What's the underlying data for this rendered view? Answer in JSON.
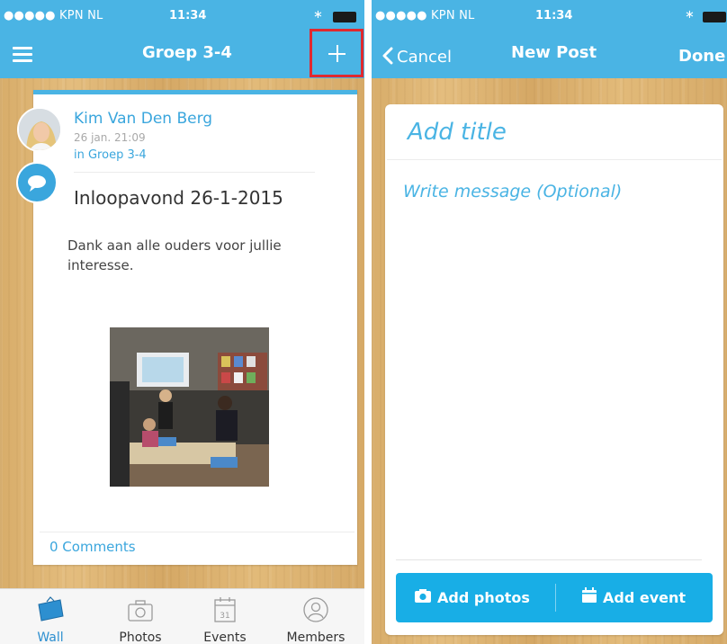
{
  "left": {
    "status": {
      "carrier": "●●●●● KPN NL",
      "time": "11:34"
    },
    "nav": {
      "title": "Groep 3-4",
      "menu_icon": "hamburger-menu-icon",
      "add_icon": "plus-icon"
    },
    "post": {
      "author": "Kim Van Den Berg",
      "date": "26 jan. 21:09",
      "group": "in Groep 3-4",
      "title": "Inloopavond 26-1-2015",
      "body": "Dank aan alle ouders voor jullie interesse.",
      "comments": "0 Comments"
    },
    "tabs": [
      {
        "label": "Wall",
        "icon": "wall-icon",
        "active": true
      },
      {
        "label": "Photos",
        "icon": "camera-icon",
        "active": false
      },
      {
        "label": "Events",
        "icon": "calendar-icon",
        "active": false
      },
      {
        "label": "Members",
        "icon": "members-icon",
        "active": false
      }
    ]
  },
  "right": {
    "status": {
      "carrier": "●●●●● KPN NL",
      "time": "11:34"
    },
    "nav": {
      "cancel": "Cancel",
      "title": "New Post",
      "done": "Done"
    },
    "form": {
      "title_placeholder": "Add title",
      "message_placeholder": "Write message (Optional)",
      "add_photos": "Add photos",
      "add_event": "Add event"
    }
  },
  "calendar_day": "31",
  "colors": {
    "brand": "#4ab4e4",
    "highlight": "#e0292f",
    "action": "#18aee6"
  }
}
